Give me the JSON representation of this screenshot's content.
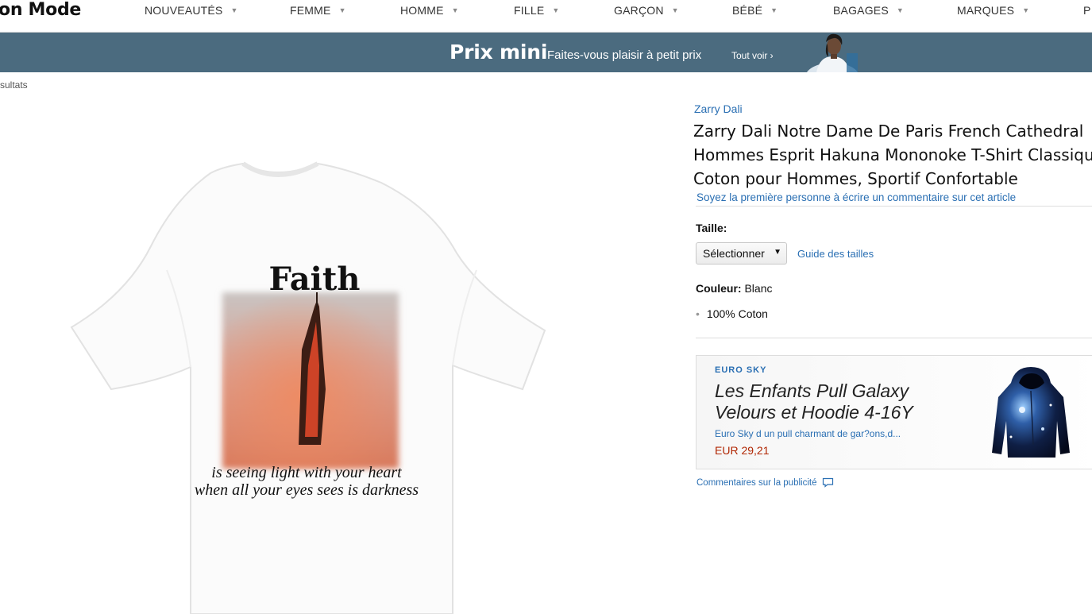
{
  "header": {
    "brand": "on Mode",
    "nav": [
      "NOUVEAUTÉS",
      "FEMME",
      "HOMME",
      "FILLE",
      "GARÇON",
      "BÉBÉ",
      "BAGAGES",
      "MARQUES",
      "P"
    ]
  },
  "banner": {
    "title": "Prix mini",
    "subtitle": "Faites-vous plaisir à petit prix",
    "link": "Tout voir ›"
  },
  "breadcrumb": "sultats",
  "tshirt": {
    "heading": "Faith",
    "caption_line1": "is seeing light with your heart",
    "caption_line2": "when all your eyes sees is darkness"
  },
  "product": {
    "brand_link": "Zarry Dali",
    "title": "Zarry Dali Notre Dame De Paris French Cathedral Hommes Esprit Hakuna Mononoke T-Shirt Classique Coton pour Hommes, Sportif Confortable",
    "review_link": "Soyez la première personne à écrire un commentaire sur cet article",
    "size_label": "Taille:",
    "size_select": "Sélectionner",
    "size_guide": "Guide des tailles",
    "color_label": "Couleur:",
    "color_value": "Blanc",
    "bullets": [
      "100% Coton"
    ]
  },
  "ad": {
    "brand": "EURO SKY",
    "title": "Les Enfants Pull Galaxy Velours et Hoodie 4-16Y",
    "description": "Euro Sky d un pull charmant de gar?ons,d...",
    "price": "EUR 29,21",
    "feedback": "Commentaires sur la publicité"
  },
  "colors": {
    "banner_bg": "#4b6b7f",
    "link": "#2a6fb3",
    "price": "#b12704"
  },
  "icons": [
    "caret-down-icon",
    "speech-bubble-icon",
    "select-arrow-icon"
  ]
}
